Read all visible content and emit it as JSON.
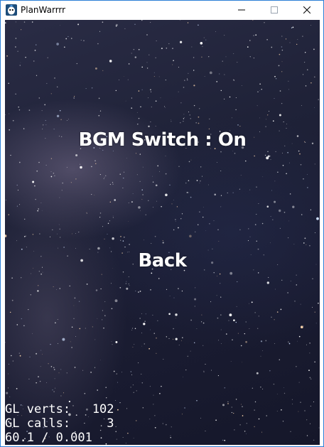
{
  "window": {
    "title": "PlanWarrrr",
    "accent_color": "#2b7fd6",
    "controls": [
      "minimize-icon",
      "maximize-icon",
      "close-icon"
    ]
  },
  "menu": {
    "bgm_switch_label": "BGM Switch : On",
    "back_label": "Back"
  },
  "debug_stats": {
    "line1": "GL verts:   102",
    "line2": "GL calls:     3",
    "line3": "60.1 / 0.001"
  }
}
